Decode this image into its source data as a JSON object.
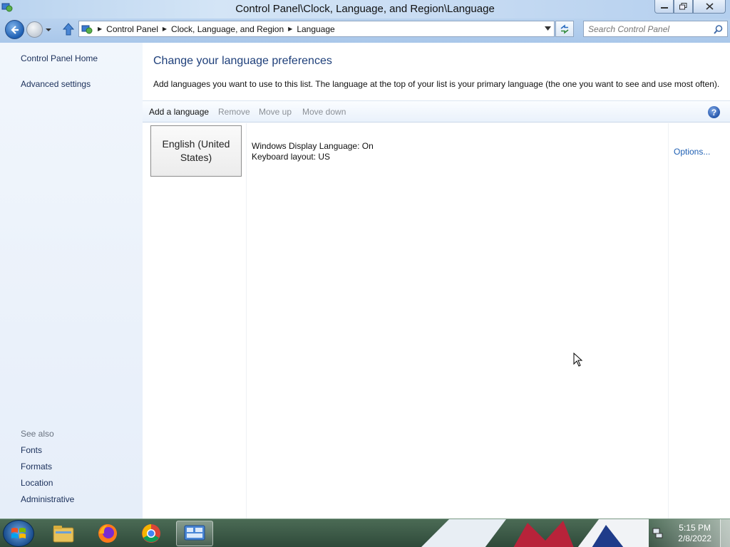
{
  "window": {
    "title": "Control Panel\\Clock, Language, and Region\\Language"
  },
  "address_bar": {
    "crumbs": [
      "Control Panel",
      "Clock, Language, and Region",
      "Language"
    ]
  },
  "search": {
    "placeholder": "Search Control Panel"
  },
  "sidebar": {
    "links": [
      "Control Panel Home",
      "Advanced settings"
    ],
    "see_also_label": "See also",
    "see_also": [
      "Fonts",
      "Formats",
      "Location",
      "Administrative"
    ]
  },
  "main": {
    "heading": "Change your language preferences",
    "description": "Add languages you want to use to this list. The language at the top of your list is your primary language (the one you want to see and use most often).",
    "toolbar": {
      "add": "Add a language",
      "remove": "Remove",
      "move_up": "Move up",
      "move_down": "Move down"
    },
    "languages": [
      {
        "name": "English (United States)",
        "display_language": "Windows Display Language: On",
        "keyboard": "Keyboard layout: US",
        "options": "Options..."
      }
    ]
  },
  "taskbar": {
    "apps": [
      "file-explorer-icon",
      "firefox-icon",
      "chrome-icon",
      "control-panel-icon"
    ],
    "time": "5:15 PM",
    "date": "2/8/2022"
  },
  "colors": {
    "accent_link": "#1e5fb3",
    "heading": "#1e3f7a"
  }
}
